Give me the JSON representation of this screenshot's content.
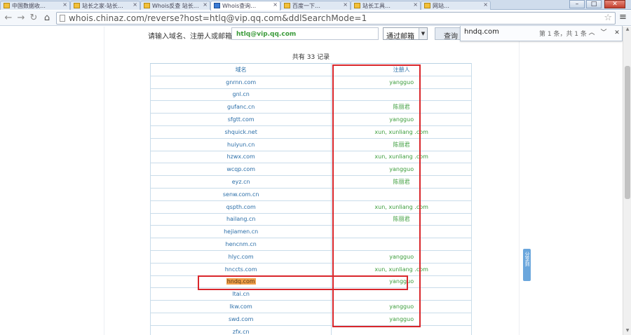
{
  "browser": {
    "tabs": [
      {
        "label": "中国数据收…",
        "active": false
      },
      {
        "label": "站长之家-站长…",
        "active": false
      },
      {
        "label": "Whois反查 站长…",
        "active": true
      },
      {
        "label": "Whois查询…",
        "active": false
      },
      {
        "label": "百度一下…",
        "active": false
      },
      {
        "label": "站长工具…",
        "active": false
      },
      {
        "label": "网站…",
        "active": false
      }
    ],
    "url": "whois.chinaz.com/reverse?host=htlq@vip.qq.com&ddlSearchMode=1",
    "window_controls": {
      "minimize": "–",
      "maximize": "□",
      "close": "✕"
    }
  },
  "search_form": {
    "label": "请输入域名、注册人或邮箱:",
    "value": "htlq@vip.qq.com",
    "mode_selected": "通过邮箱",
    "submit_label": "查询"
  },
  "find_bar": {
    "query": "hndq.com",
    "count": "第 1 条，共 1 条"
  },
  "results": {
    "summary": "共有 33 记录",
    "headers": {
      "domain": "域名",
      "registrant": "注册人"
    },
    "rows": [
      {
        "domain": "gnrnn.com",
        "registrant": "yangguo"
      },
      {
        "domain": "gnl.cn",
        "registrant": ""
      },
      {
        "domain": "gufanc.cn",
        "registrant": "陈丽君"
      },
      {
        "domain": "sfgtt.com",
        "registrant": "yangguo"
      },
      {
        "domain": "shquick.net",
        "registrant": "xun, xunliang .com"
      },
      {
        "domain": "huiyun.cn",
        "registrant": "陈丽君"
      },
      {
        "domain": "hzwx.com",
        "registrant": "xun, xunliang .com"
      },
      {
        "domain": "wcqp.com",
        "registrant": "yangguo"
      },
      {
        "domain": "eyz.cn",
        "registrant": "陈丽君"
      },
      {
        "domain": "senw.com.cn",
        "registrant": ""
      },
      {
        "domain": "qspth.com",
        "registrant": "xun, xunliang .com"
      },
      {
        "domain": "hailang.cn",
        "registrant": "陈丽君"
      },
      {
        "domain": "hejiamen.cn",
        "registrant": ""
      },
      {
        "domain": "hencnm.cn",
        "registrant": ""
      },
      {
        "domain": "hlyc.com",
        "registrant": "yangguo"
      },
      {
        "domain": "hnccts.com",
        "registrant": "xun, xunliang .com"
      },
      {
        "domain": "hndq.com",
        "registrant": "yangguo",
        "highlight": true
      },
      {
        "domain": "ltai.cn",
        "registrant": ""
      },
      {
        "domain": "lkw.com",
        "registrant": "yangguo"
      },
      {
        "domain": "swd.com",
        "registrant": "yangguo"
      },
      {
        "domain": "zfx.cn",
        "registrant": ""
      }
    ]
  },
  "side_widget": {
    "label": "分享到"
  },
  "colors": {
    "annotation": "#d9262b",
    "domain_link": "#2b6ea8",
    "registrant": "#3c9d3c",
    "find_highlight": "#f0a04b"
  }
}
